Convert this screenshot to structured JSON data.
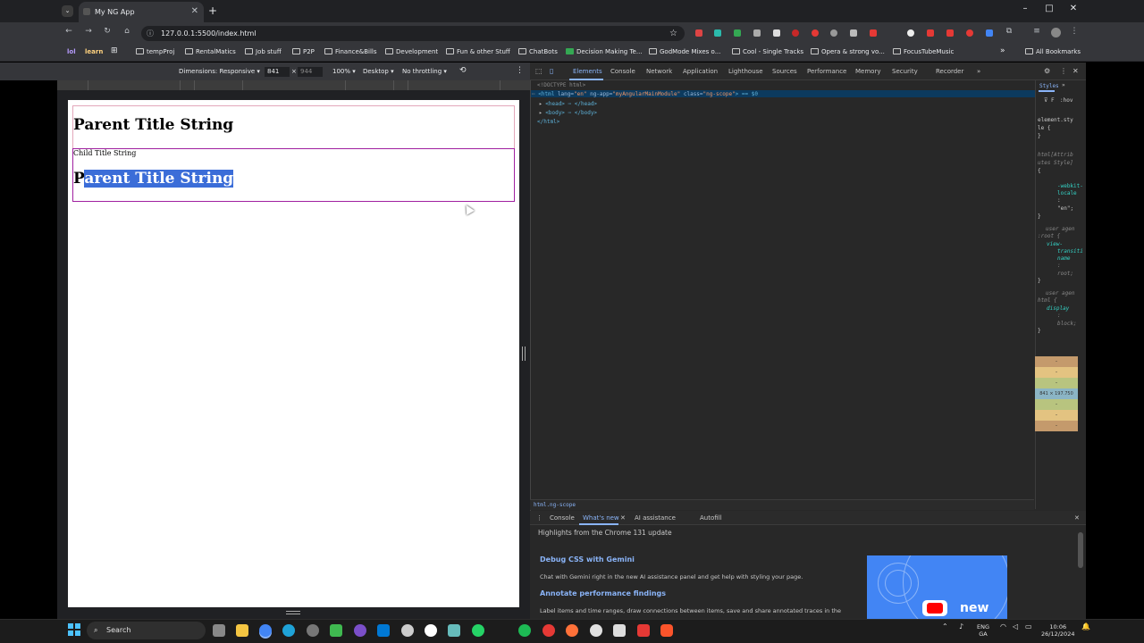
{
  "window": {
    "tab_title": "My NG App",
    "address": "127.0.0.1:5500/index.html",
    "controls": {
      "minimize": "–",
      "maximize": "□",
      "close": "✕"
    }
  },
  "bookmarks": {
    "lol": "lol",
    "learn": "learn",
    "items": [
      "tempProj",
      "RentalMatics",
      "Job stuff",
      "P2P",
      "Finance&Bills",
      "Development",
      "Fun & other Stuff",
      "ChatBots",
      "Decision Making Te...",
      "GodMode Mixes o...",
      "Cool - Single Tracks",
      "Opera & strong vo...",
      "FocusTubeMusic"
    ],
    "more": "»",
    "all": "All Bookmarks"
  },
  "device_toolbar": {
    "dimensions": "Dimensions: Responsive ▾",
    "width": "841",
    "times": "×",
    "height": "944",
    "zoom": "100% ▾",
    "device": "Desktop ▾",
    "throttle": "No throttling ▾"
  },
  "viewport": {
    "parent_title": "Parent Title String",
    "child_label": "Child Title String",
    "parent_echo_first": "P",
    "parent_echo_selected": "arent Title String"
  },
  "devtools": {
    "tabs": [
      "Elements",
      "Console",
      "Network",
      "Application",
      "Lighthouse",
      "Sources",
      "Performance",
      "Memory",
      "Security",
      "Recorder"
    ],
    "active_tab": "Elements",
    "dom": {
      "doctype": "<!DOCTYPE html>",
      "html_open": "<html",
      "lang_attr": "lang=",
      "lang_val": "\"en\"",
      "app_attr": "ng-app=",
      "app_val": "\"myAngularMainModule\"",
      "class_attr": "class=",
      "class_val": "\"ng-scope\"",
      "html_suffix": "> == $0",
      "head": "<head> ⋯ </head>",
      "body": "<body> ⋯ </body>",
      "html_close": "</html>"
    },
    "breadcrumb": "html.ng-scope",
    "styles": {
      "tab": "Styles",
      "filter": "F",
      "show": ":hov",
      "element_style_1": "element.sty",
      "element_style_2": "le {",
      "close": "}",
      "html_attr_1": "html[Attrib",
      "html_attr_2": "utes Style]",
      "open": "{",
      "webkit": "-webkit-",
      "locale": "locale",
      "semi": ":",
      "en": "\"en\";",
      "ua1": "user agen",
      "root": ":root {",
      "view": "view-",
      "transition": "transiti",
      "name": "name",
      "root_val": "root;",
      "ua2": "user agen",
      "html_rule": "html {",
      "display": "display",
      "block": "block;",
      "box_dims": "841 × 197.750"
    }
  },
  "drawer": {
    "tabs": [
      "Console",
      "What's new",
      "AI assistance",
      "Autofill"
    ],
    "active_tab": "What's new",
    "highlights": "Highlights from the Chrome 131 update",
    "item1_title": "Debug CSS with Gemini",
    "item1_body": "Chat with Gemini right in the new AI assistance panel and get help with styling your page.",
    "item2_title": "Annotate performance findings",
    "item2_body": "Label items and time ranges, draw connections between items, save and share annotated traces in the",
    "video_label": "new"
  },
  "taskbar": {
    "search": "Search",
    "lang1": "ENG",
    "lang2": "GA",
    "time": "10:06",
    "date": "26/12/2024"
  }
}
